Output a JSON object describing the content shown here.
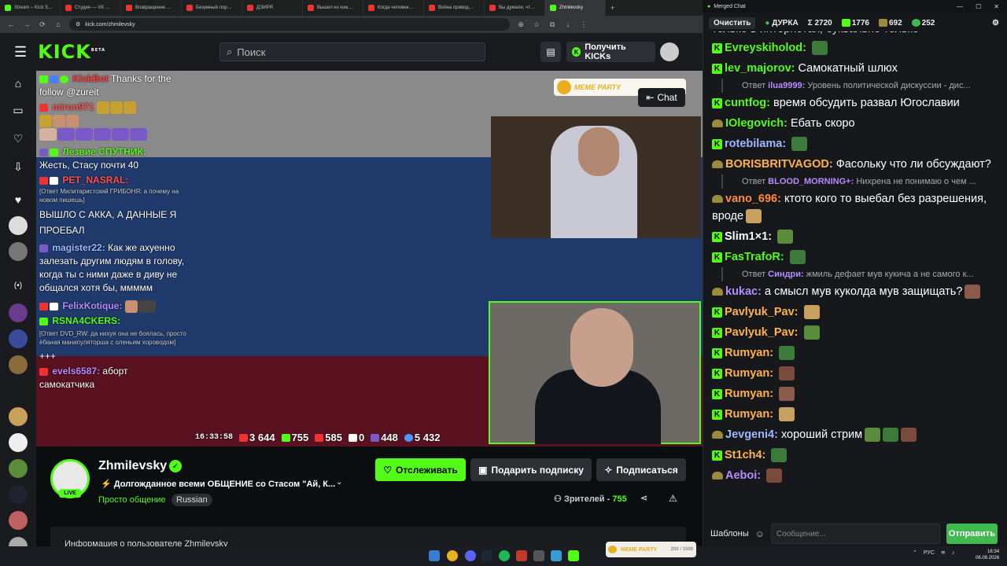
{
  "browser": {
    "tabs": [
      "Stream – Kick S…",
      "Студия — VK …",
      "Возвращение …",
      "Безумный лор…",
      "ДЭИРЯ",
      "Вышел из ком…",
      "Когда человек…",
      "Война привод…",
      "Вы думали, чт…",
      "Zhmilevsky"
    ],
    "url": "kick.com/zhmilevsky",
    "new_tab": "+"
  },
  "header": {
    "logo": "KICK",
    "logo_sup": "BETA",
    "search_placeholder": "Поиск",
    "kicks_button": "Получить KICKs"
  },
  "overlay": {
    "meme_party": "MEME PARTY",
    "chat_button": "Chat",
    "messages": [
      {
        "name": "KickBot",
        "color": "#ff3b3b",
        "text": "Thanks for the follow @zureit"
      },
      {
        "name": "miron971",
        "color": "#ff5050",
        "text": ""
      },
      {
        "name": "Лезвие СПУТНИК:",
        "color": "#53fc18",
        "text": "Жесть, Стасу почти 40"
      },
      {
        "name": "PET_NASRAL:",
        "color": "#ff5050",
        "reply": "[Ответ Милитаристский ГРИБОНЯ: а почему на новом пишешь]",
        "text": "ВЫШЛО С АККА, А ДАННЫЕ Я ПРОЕБАЛ"
      },
      {
        "name": "magister22:",
        "color": "#9fb8ff",
        "text": "Как же ахуенно залезать другим людям в голову, когда ты с ними даже в диву не общался хотя бы, ммммм"
      },
      {
        "name": "FelixKotique:",
        "color": "#b58cff",
        "text": ""
      },
      {
        "name": "RSNA4CKERS:",
        "color": "#53fc18",
        "reply": "[Ответ DVD_RW: да нихуя она не боялась, просто ёбаная манипуляторша с оленьим хороводом]",
        "text": "+++"
      },
      {
        "name": "evels6587:",
        "color": "#b58cff",
        "text": "аборт самокатчика"
      }
    ],
    "stats": {
      "time": "16:33:58",
      "yt": "3 644",
      "kick": "755",
      "vk": "585",
      "r": "0",
      "tw": "448",
      "viewers": "5 432"
    }
  },
  "channel": {
    "name": "Zhmilevsky",
    "live": "LIVE",
    "title": "Долгожданное всеми ОБЩЕНИЕ со Стасом \"Ай, К...",
    "category": "Просто общение",
    "language": "Russian",
    "follow": "Отслеживать",
    "gift": "Подарить подписку",
    "subscribe": "Подписаться",
    "viewers_label": "Зрителей -",
    "viewers_count": "755",
    "about": "Информация о пользователе Zhmilevsky"
  },
  "chat_window": {
    "title": "Merged Chat",
    "clear": "Очистить",
    "channel": "ДУРКА",
    "stats": {
      "total": "Σ 2720",
      "kick": "1776",
      "tw": "692",
      "vk": "252"
    },
    "top_cut": "только в интернотах, буквально только",
    "messages": [
      {
        "src": "k",
        "name": "Evreyskiholod:",
        "color": "#53fc18",
        "text": "",
        "emotes": 1
      },
      {
        "src": "k",
        "name": "lev_majorov:",
        "color": "#53fc18",
        "text": "Самокатный шлюх",
        "emotes": 0
      },
      {
        "reply_name": "ilua9999:",
        "reply_text": "Уровень политической дискуссии - дис..."
      },
      {
        "src": "k",
        "name": "cuntfog:",
        "color": "#53fc18",
        "text": "время обсудить развал Югославии",
        "emotes": 0
      },
      {
        "src": "t",
        "name": "IOlegovich:",
        "color": "#53fc18",
        "text": "Ебать скоро",
        "emotes": 0
      },
      {
        "src": "k",
        "name": "rotebilama:",
        "color": "#9fb8ff",
        "text": "",
        "emotes": 1
      },
      {
        "src": "t",
        "name": "BORISBRITVAGOD:",
        "color": "#ffb347",
        "text": "Фасольку что ли обсуждают?",
        "emotes": 0
      },
      {
        "reply_name": "BLOOD_MORNING+:",
        "reply_text": "Нихрена не понимаю о чем ..."
      },
      {
        "src": "t",
        "name": "vano_696:",
        "color": "#ff8a3b",
        "text": "ктото кого то выебал без разрешения, вроде",
        "emotes": 1
      },
      {
        "src": "k",
        "name": "Slim1×1:",
        "color": "#fff",
        "text": "",
        "emotes": 1
      },
      {
        "src": "k",
        "name": "FasTrafoR:",
        "color": "#53fc18",
        "text": "",
        "emotes": 1
      },
      {
        "reply_name": "Синдри:",
        "reply_text": "жмиль дефает мув кукича а не самого к..."
      },
      {
        "src": "t",
        "name": "kukac:",
        "color": "#b58cff",
        "text": "а смысл мув куколда мув защищать?",
        "emotes": 1
      },
      {
        "src": "k",
        "name": "Pavlyuk_Pav:",
        "color": "#ffb347",
        "text": "",
        "emotes": 1
      },
      {
        "src": "k",
        "name": "Pavlyuk_Pav:",
        "color": "#ffb347",
        "text": "",
        "emotes": 1
      },
      {
        "src": "k",
        "name": "Rumyan:",
        "color": "#ffb347",
        "text": "",
        "emotes": 1
      },
      {
        "src": "k",
        "name": "Rumyan:",
        "color": "#ffb347",
        "text": "",
        "emotes": 1
      },
      {
        "src": "k",
        "name": "Rumyan:",
        "color": "#ffb347",
        "text": "",
        "emotes": 1
      },
      {
        "src": "k",
        "name": "Rumyan:",
        "color": "#ffb347",
        "text": "",
        "emotes": 1
      },
      {
        "src": "t",
        "name": "Jevgeni4:",
        "color": "#9fb8ff",
        "text": "хороший стрим",
        "emotes": 3
      },
      {
        "src": "k",
        "name": "St1ch4:",
        "color": "#ffb347",
        "text": "",
        "emotes": 1
      },
      {
        "src": "t",
        "name": "Aeboi:",
        "color": "#b58cff",
        "text": "",
        "emotes": 1
      }
    ],
    "templates": "Шаблоны",
    "input_placeholder": "Сообщение...",
    "send": "Отправить"
  },
  "taskbar": {
    "tray_lang": "РУС",
    "clock_time": "16:34",
    "clock_date": "06.08.2026",
    "meme_party": "MEME PARTY",
    "counter": "200 / 1500"
  },
  "colors": {
    "kick_green": "#53fc18",
    "send_green": "#3fb950",
    "bg": "#0b0e0f"
  }
}
